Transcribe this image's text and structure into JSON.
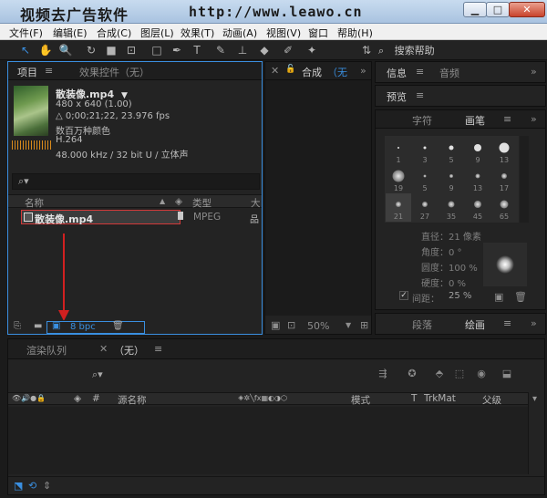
{
  "window": {
    "title": "视频去广告软件",
    "url": "http://www.leawo.cn",
    "min_glyph": "▁",
    "max_glyph": "□",
    "close_glyph": "✕"
  },
  "menu": [
    "文件(F)",
    "编辑(E)",
    "合成(C)",
    "图层(L)",
    "效果(T)",
    "动画(A)",
    "视图(V)",
    "窗口",
    "帮助(H)"
  ],
  "toolbar": {
    "icons": [
      "selection-tool-icon",
      "hand-tool-icon",
      "zoom-tool-icon",
      "rotate-tool-icon",
      "camera-tool-icon",
      "pan-behind-icon",
      "rectangle-tool-icon",
      "pen-tool-icon",
      "type-tool-icon",
      "brush-tool-icon",
      "clone-stamp-icon",
      "eraser-icon",
      "roto-brush-icon",
      "puppet-pin-icon"
    ],
    "glyphs": [
      "↖",
      "✋",
      "🔍",
      "↻",
      "■",
      "⊡",
      "□",
      "✒",
      "T",
      "✎",
      "⊥",
      "◆",
      "✐",
      "✦"
    ],
    "workspace_glyph": "⇅",
    "search_help": "搜索帮助",
    "search_glyph": "⌕"
  },
  "project_panel": {
    "tab_project": "项目",
    "tab_effects": "效果控件（无）",
    "menu_glyph": "≡",
    "file": {
      "name": "散装像.mp4",
      "dropdown": "▼",
      "resolution": "480 x 640 (1.00)",
      "duration": "△ 0;00;21;22, 23.976 fps",
      "colors": "数百万种颜色",
      "codec": "H.264",
      "audio": "48.000 kHz / 32 bit U / 立体声"
    },
    "search_glyph": "⌕▾",
    "columns": {
      "name": "名称",
      "sort": "▲",
      "label": "◈",
      "type": "类型",
      "size": "大"
    },
    "row": {
      "name": "散装像.mp4",
      "type": "MPEG",
      "tree": "品"
    },
    "footer": {
      "bpc": "8 bpc",
      "icons": [
        "interpret-footage-icon",
        "new-folder-icon",
        "new-composition-icon",
        "trash-icon"
      ],
      "glyphs": [
        "⎘",
        "▬",
        "▣",
        "🗑"
      ]
    }
  },
  "comp_panel": {
    "close": "✕",
    "lock": "🔓",
    "tab": "合成",
    "tab_value": "（无",
    "more": "»",
    "zoom": "50%",
    "zoom_dd": "▼",
    "footer_glyphs": [
      "▣",
      "⊡",
      "⊞"
    ]
  },
  "info_panel": {
    "tab_info": "信息",
    "tab_audio": "音频",
    "menu_glyph": "≡",
    "more": "»"
  },
  "preview_panel": {
    "tab": "预览",
    "menu_glyph": "≡"
  },
  "brush_panel": {
    "tab_char": "字符",
    "tab_brush": "画笔",
    "menu_glyph": "≡",
    "more": "»",
    "brushes": [
      {
        "n": "1",
        "d": 2
      },
      {
        "n": "3",
        "d": 3
      },
      {
        "n": "5",
        "d": 5
      },
      {
        "n": "9",
        "d": 8
      },
      {
        "n": "13",
        "d": 11
      },
      {
        "n": "19",
        "d": 13
      },
      {
        "n": "5",
        "d": 3
      },
      {
        "n": "9",
        "d": 4
      },
      {
        "n": "13",
        "d": 5
      },
      {
        "n": "17",
        "d": 6
      },
      {
        "n": "21",
        "d": 6
      },
      {
        "n": "27",
        "d": 6
      },
      {
        "n": "35",
        "d": 7
      },
      {
        "n": "45",
        "d": 8
      },
      {
        "n": "65",
        "d": 9
      }
    ],
    "diameter": "直径：21 像素",
    "angle": "角度：0 °",
    "roundness": "圆度：100 %",
    "hardness": "硬度：0 %",
    "spacing_label": "间距：",
    "spacing_value": "25 %",
    "check_glyph": "✓",
    "footer_glyphs": [
      "▣",
      "🗑"
    ]
  },
  "para_panel": {
    "tab_para": "段落",
    "tab_paint": "绘画",
    "menu_glyph": "≡",
    "more": "»"
  },
  "timeline": {
    "tab_render": "渲染队列",
    "close": "✕",
    "tab_none": "（无）",
    "menu_glyph": "≡",
    "search_glyph": "⌕▾",
    "toolbar_glyphs": [
      "⇶",
      "✪",
      "⬘",
      "⬚",
      "◉",
      "⬓"
    ],
    "columns": {
      "switches_left": "👁🔊●🔒",
      "label": "◈",
      "num": "#",
      "source": "源名称",
      "switches_mid": "🞛✲╲fx▦◐◑⬡",
      "mode": "模式",
      "t": "T",
      "trkmat": "TrkMat",
      "parent": "父级"
    },
    "scroll_glyph": "▾",
    "footer_glyphs": [
      "⬔",
      "⟲",
      "⇕"
    ]
  }
}
